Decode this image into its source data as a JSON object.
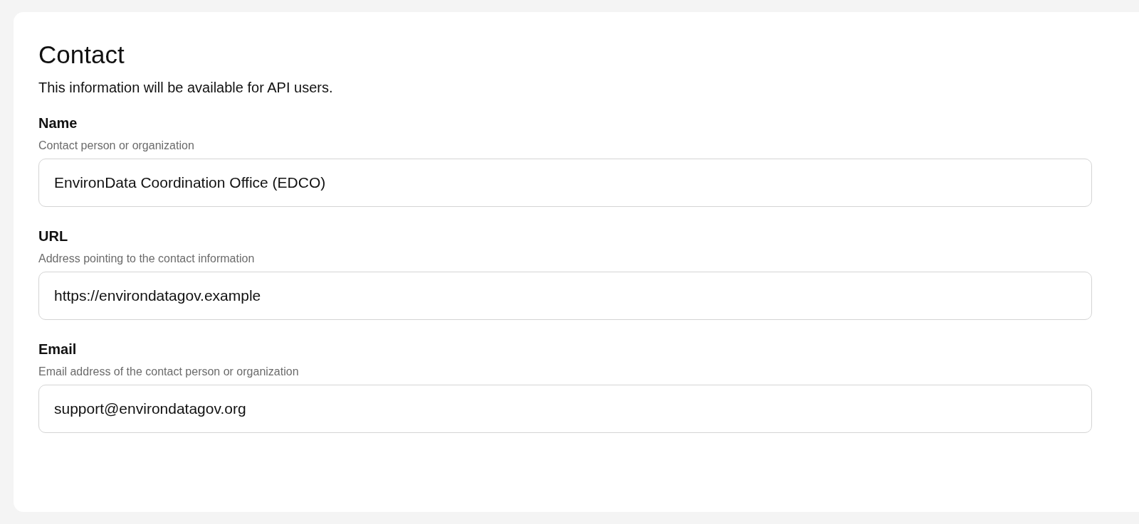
{
  "section": {
    "title": "Contact",
    "description": "This information will be available for API users."
  },
  "fields": [
    {
      "label": "Name",
      "hint": "Contact person or organization",
      "value": "EnvironData Coordination Office (EDCO)"
    },
    {
      "label": "URL",
      "hint": "Address pointing to the contact information",
      "value": "https://environdatagov.example"
    },
    {
      "label": "Email",
      "hint": "Email address of the contact person or organization",
      "value": "support@environdatagov.org"
    }
  ]
}
